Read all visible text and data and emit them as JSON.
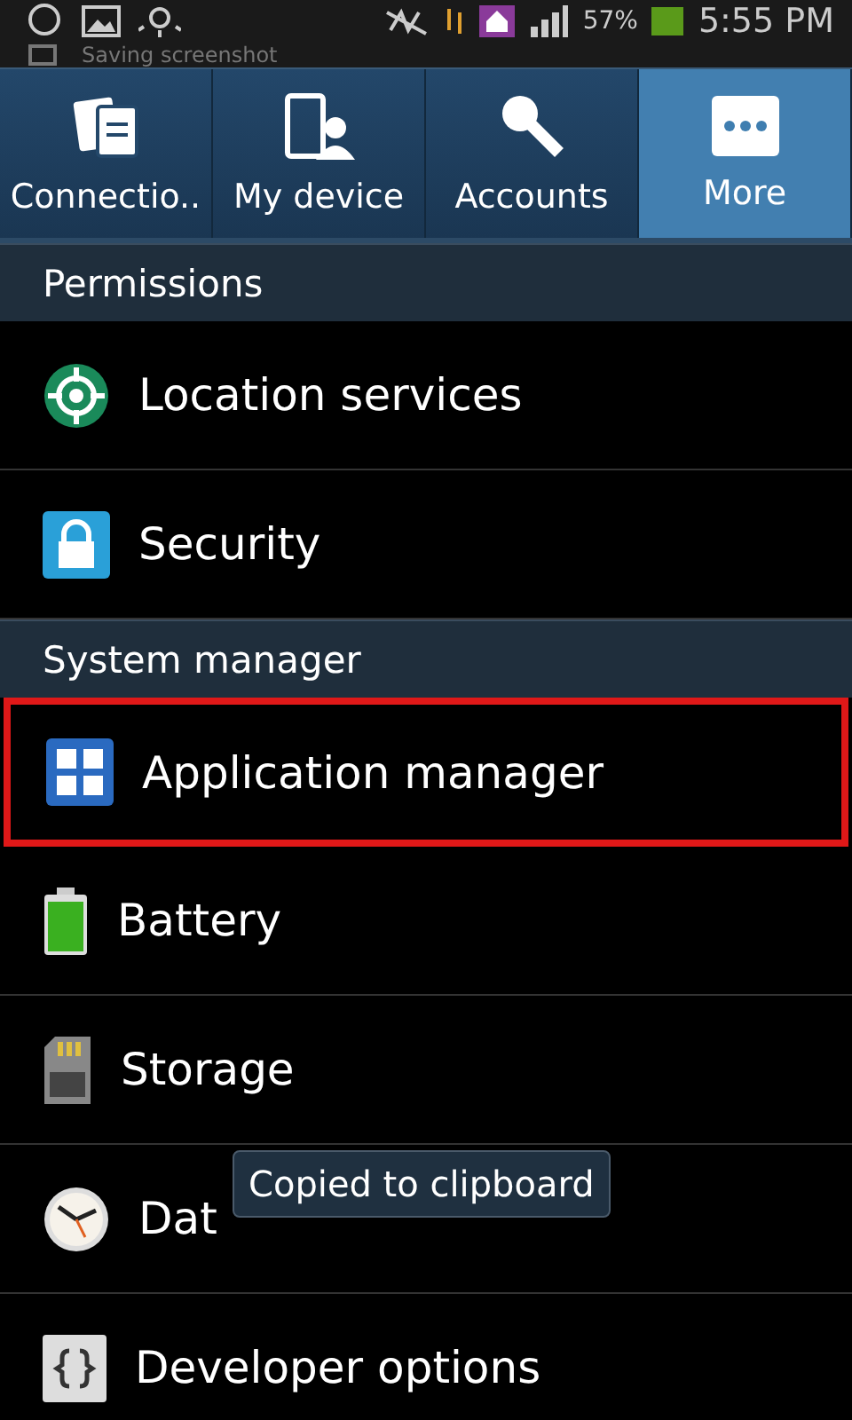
{
  "status_bar": {
    "battery_text": "57%",
    "time": "5:55 PM",
    "notification": "Saving screenshot"
  },
  "tabs": [
    {
      "label": "Connectio..",
      "selected": false
    },
    {
      "label": "My device",
      "selected": false
    },
    {
      "label": "Accounts",
      "selected": false
    },
    {
      "label": "More",
      "selected": true
    }
  ],
  "sections": [
    {
      "title": "Permissions",
      "items": [
        {
          "label": "Location services",
          "selected": false
        },
        {
          "label": "Security",
          "selected": false
        }
      ]
    },
    {
      "title": "System manager",
      "items": [
        {
          "label": "Application manager",
          "selected": true
        },
        {
          "label": "Battery",
          "selected": false
        },
        {
          "label": "Storage",
          "selected": false
        },
        {
          "label": "Dat",
          "selected": false
        },
        {
          "label": "Developer options",
          "selected": false
        }
      ]
    }
  ],
  "toast": "Copied to clipboard"
}
